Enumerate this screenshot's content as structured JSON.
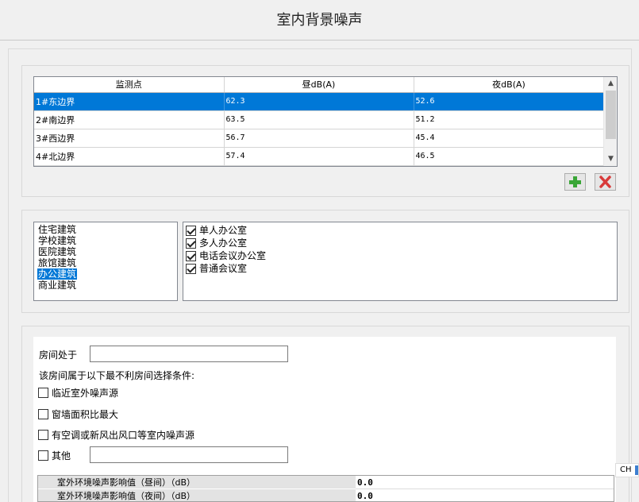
{
  "title": "室内背景噪声",
  "table": {
    "headers": [
      "监测点",
      "昼dB(A)",
      "夜dB(A)"
    ],
    "rows": [
      [
        "1#东边界",
        "62.3",
        "52.6"
      ],
      [
        "2#南边界",
        "63.5",
        "51.2"
      ],
      [
        "3#西边界",
        "56.7",
        "45.4"
      ],
      [
        "4#北边界",
        "57.4",
        "46.5"
      ]
    ],
    "selected_row": 0
  },
  "buttons": {
    "add_icon": "plus-icon",
    "delete_icon": "x-icon",
    "add_color": "#3aa637",
    "delete_color": "#d83a3a"
  },
  "building_types": {
    "items": [
      "住宅建筑",
      "学校建筑",
      "医院建筑",
      "旅馆建筑",
      "办公建筑",
      "商业建筑"
    ],
    "selected": "办公建筑"
  },
  "room_types": {
    "items": [
      "单人办公室",
      "多人办公室",
      "电话会议办公室",
      "普通会议室"
    ],
    "checked": [
      true,
      true,
      true,
      true
    ]
  },
  "room_location": {
    "label": "房间处于",
    "value": ""
  },
  "conditions": {
    "heading": "该房间属于以下最不利房间选择条件:",
    "items": [
      "临近室外噪声源",
      "窗墙面积比最大",
      "有空调或新风出风口等室内噪声源",
      "其他"
    ],
    "checked": [
      false,
      false,
      false,
      false
    ],
    "other_value": ""
  },
  "results": {
    "rows": [
      {
        "label": "室外环境噪声影响值（昼间）（dB）",
        "value": "0.0"
      },
      {
        "label": "室外环境噪声影响值（夜间）（dB）",
        "value": "0.0"
      }
    ]
  },
  "ime_indicator": "CH",
  "colors": {
    "selection": "#0078d7"
  }
}
